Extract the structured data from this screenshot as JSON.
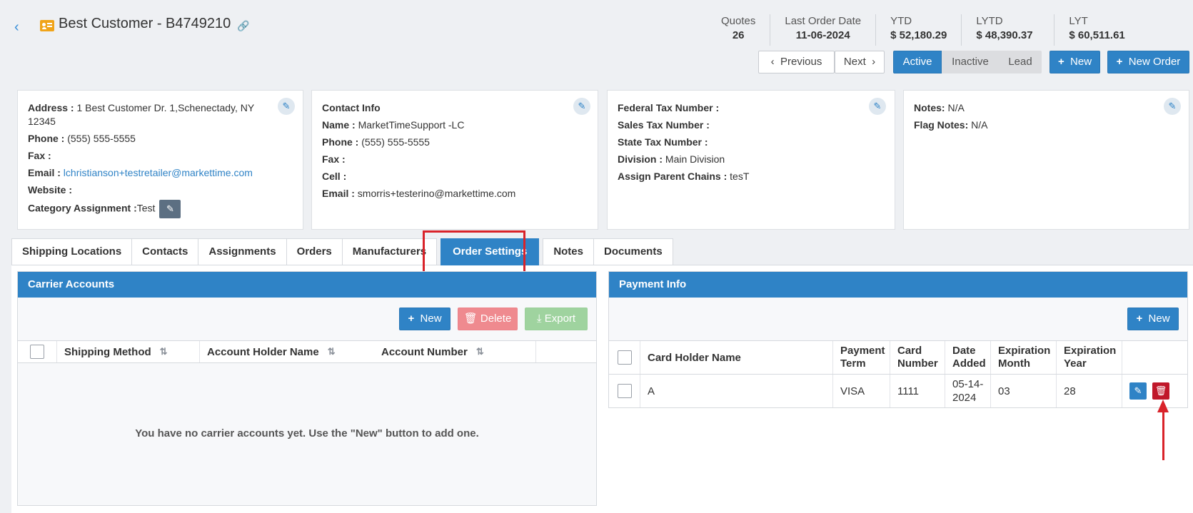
{
  "header": {
    "title": "Best Customer - B4749210",
    "stats": [
      {
        "label": "Quotes",
        "value": "26"
      },
      {
        "label": "Last Order Date",
        "value": "11-06-2024"
      },
      {
        "label": "YTD",
        "value": "$ 52,180.29"
      },
      {
        "label": "LYTD",
        "value": "$ 48,390.37"
      },
      {
        "label": "LYT",
        "value": "$ 60,511.61"
      }
    ],
    "buttons": {
      "previous": "Previous",
      "next": "Next",
      "active": "Active",
      "inactive": "Inactive",
      "lead": "Lead",
      "new": "New",
      "new_order": "New Order"
    }
  },
  "cards": {
    "address": {
      "address_label": "Address :",
      "address_value_1": "1 Best Customer Dr. 1,Schenectady, NY",
      "address_value_2": "12345",
      "phone_label": "Phone :",
      "phone_value": "(555) 555-5555",
      "fax_label": "Fax :",
      "email_label": "Email :",
      "email_value": "lchristianson+testretailer@markettime.com",
      "website_label": "Website :",
      "category_label": "Category Assignment :",
      "category_value": "Test"
    },
    "contact": {
      "title": "Contact Info",
      "name_label": "Name :",
      "name_value": "MarketTimeSupport -LC",
      "phone_label": "Phone :",
      "phone_value": "(555) 555-5555",
      "fax_label": "Fax :",
      "cell_label": "Cell :",
      "email_label": "Email :",
      "email_value": "smorris+testerino@markettime.com"
    },
    "tax": {
      "federal_label": "Federal Tax Number :",
      "sales_label": "Sales Tax Number :",
      "state_label": "State Tax Number :",
      "division_label": "Division :",
      "division_value": "Main Division",
      "chains_label": "Assign Parent Chains :",
      "chains_value": "tesT"
    },
    "notes": {
      "notes_label": "Notes:",
      "notes_value": "N/A",
      "flag_label": "Flag Notes:",
      "flag_value": "N/A"
    }
  },
  "tabs": [
    "Shipping Locations",
    "Contacts",
    "Assignments",
    "Orders",
    "Manufacturers",
    "Order Settings",
    "Notes",
    "Documents"
  ],
  "active_tab": "Order Settings",
  "carrier": {
    "title": "Carrier Accounts",
    "new_label": "New",
    "delete_label": "Delete",
    "export_label": "Export",
    "columns": [
      "Shipping Method",
      "Account Holder Name",
      "Account Number"
    ],
    "empty_message": "You have no carrier accounts yet. Use the \"New\" button to add one."
  },
  "payment": {
    "title": "Payment Info",
    "new_label": "New",
    "columns": {
      "card_holder": "Card Holder Name",
      "payment_term_1": "Payment",
      "payment_term_2": "Term",
      "card_number_1": "Card",
      "card_number_2": "Number",
      "date_added_1": "Date",
      "date_added_2": "Added",
      "exp_month_1": "Expiration",
      "exp_month_2": "Month",
      "exp_year_1": "Expiration",
      "exp_year_2": "Year"
    },
    "rows": [
      {
        "card_holder": "A",
        "payment_term": "VISA",
        "card_number": "1111",
        "date_added_1": "05-14-",
        "date_added_2": "2024",
        "exp_month": "03",
        "exp_year": "28"
      }
    ]
  },
  "colors": {
    "primary": "#2f83c6",
    "annotation": "#d9232a",
    "delete": "#c0182a"
  }
}
